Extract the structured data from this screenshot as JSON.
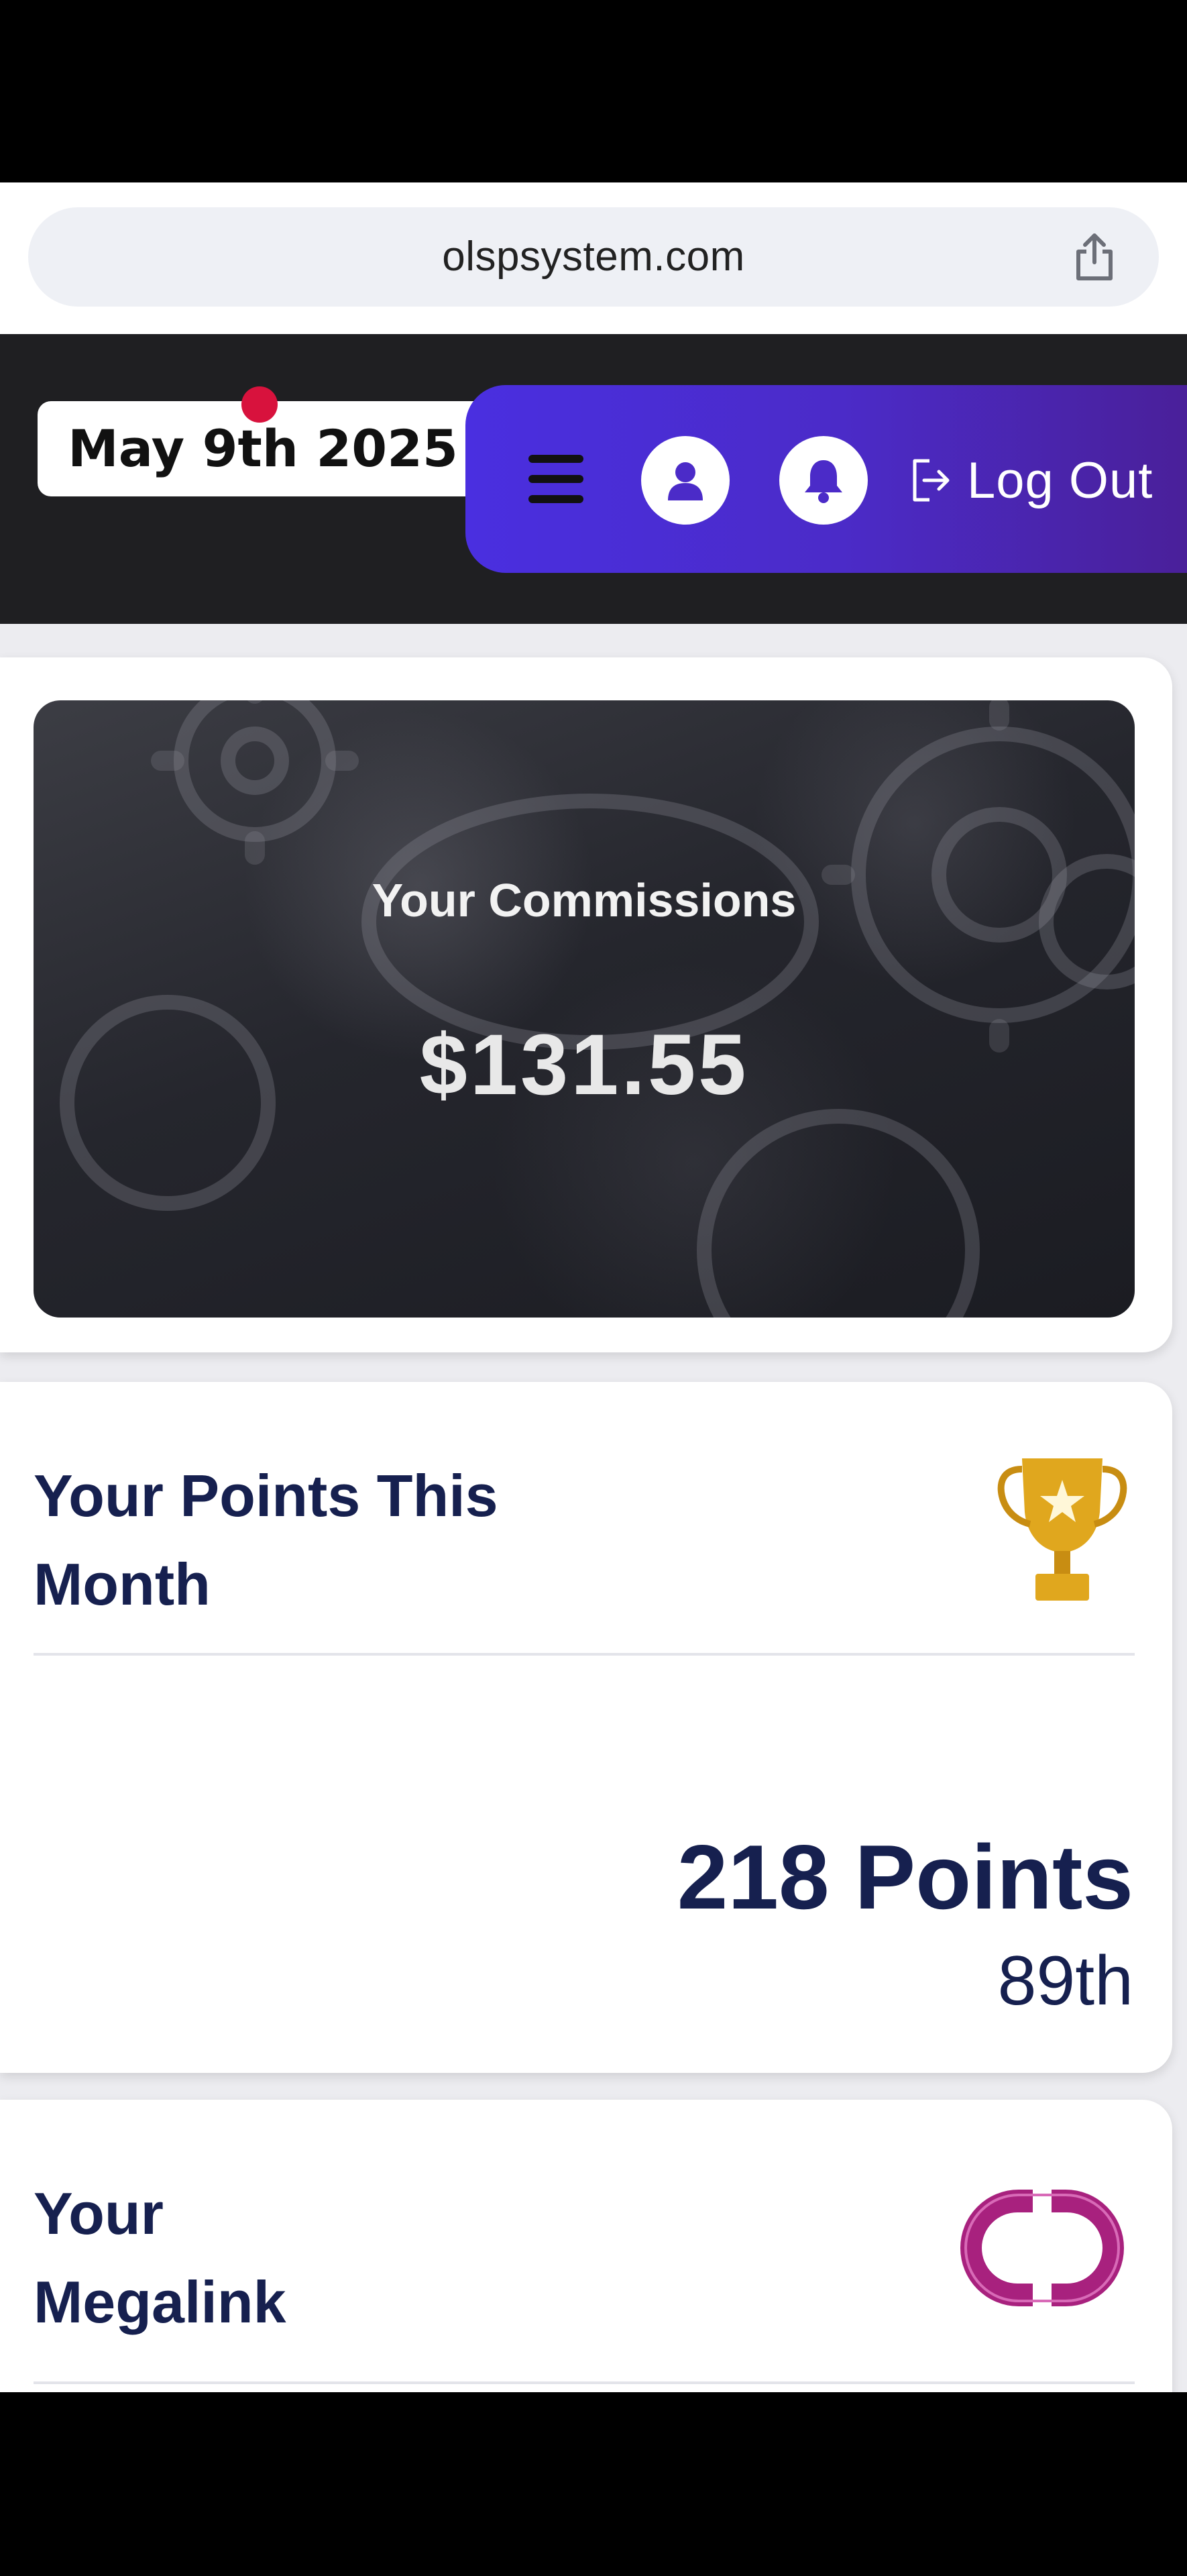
{
  "browser": {
    "url": "olspsystem.com",
    "share_icon": "share-icon"
  },
  "header": {
    "date_badge": "May 9th 2025",
    "menu_icon": "hamburger-icon",
    "user_icon": "user-icon",
    "bell_icon": "bell-icon",
    "logout_label": "Log Out",
    "logout_icon": "logout-icon",
    "accent_gradient": [
      "#4a2fe0",
      "#4a1f96"
    ]
  },
  "commissions": {
    "label": "Your Commissions",
    "amount": "$131.55"
  },
  "points": {
    "title": "Your Points This Month",
    "value": "218 Points",
    "rank": "89th",
    "icon": "trophy-icon"
  },
  "megalink": {
    "title": "Your Megalink",
    "icon": "megalink-icon"
  },
  "colors": {
    "title_navy": "#16204f",
    "trophy_gold": "#e0a71e",
    "megalink_magenta": "#a8217e",
    "record_dot": "#d8123d"
  }
}
